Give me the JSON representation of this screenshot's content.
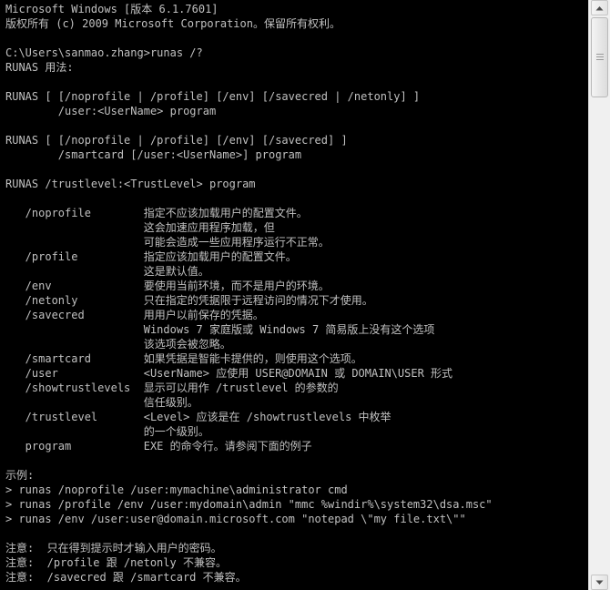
{
  "console": {
    "lines": [
      "Microsoft Windows [版本 6.1.7601]",
      "版权所有 (c) 2009 Microsoft Corporation。保留所有权利。",
      "",
      "C:\\Users\\sanmao.zhang>runas /?",
      "RUNAS 用法:",
      "",
      "RUNAS [ [/noprofile | /profile] [/env] [/savecred | /netonly] ]",
      "        /user:<UserName> program",
      "",
      "RUNAS [ [/noprofile | /profile] [/env] [/savecred] ]",
      "        /smartcard [/user:<UserName>] program",
      "",
      "RUNAS /trustlevel:<TrustLevel> program",
      "",
      "   /noprofile        指定不应该加载用户的配置文件。",
      "                     这会加速应用程序加载，但",
      "                     可能会造成一些应用程序运行不正常。",
      "   /profile          指定应该加载用户的配置文件。",
      "                     这是默认值。",
      "   /env              要使用当前环境，而不是用户的环境。",
      "   /netonly          只在指定的凭据限于远程访问的情况下才使用。",
      "   /savecred         用用户以前保存的凭据。",
      "                     Windows 7 家庭版或 Windows 7 简易版上没有这个选项",
      "                     该选项会被忽略。",
      "   /smartcard        如果凭据是智能卡提供的，则使用这个选项。",
      "   /user             <UserName> 应使用 USER@DOMAIN 或 DOMAIN\\USER 形式",
      "   /showtrustlevels  显示可以用作 /trustlevel 的参数的",
      "                     信任级别。",
      "   /trustlevel       <Level> 应该是在 /showtrustlevels 中枚举",
      "                     的一个级别。",
      "   program           EXE 的命令行。请参阅下面的例子",
      "",
      "示例:",
      "> runas /noprofile /user:mymachine\\administrator cmd",
      "> runas /profile /env /user:mydomain\\admin \"mmc %windir%\\system32\\dsa.msc\"",
      "> runas /env /user:user@domain.microsoft.com \"notepad \\\"my file.txt\\\"\"",
      "",
      "注意:  只在得到提示时才输入用户的密码。",
      "注意:  /profile 跟 /netonly 不兼容。",
      "注意:  /savecred 跟 /smartcard 不兼容。"
    ]
  },
  "scrollbar": {
    "up_icon": "arrow-up-icon",
    "down_icon": "arrow-down-icon"
  }
}
